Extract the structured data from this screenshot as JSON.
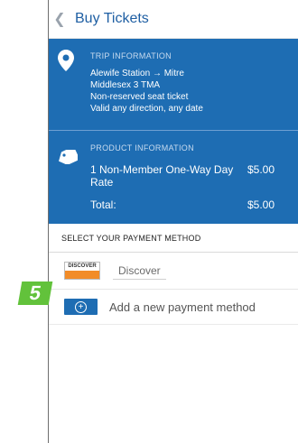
{
  "header": {
    "back_icon": "chevron-left-icon",
    "title": "Buy Tickets"
  },
  "trip": {
    "icon": "map-pin-icon",
    "label": "TRIP INFORMATION",
    "from": "Alewife Station",
    "arrow": "→",
    "to": "Mitre",
    "line2": "Middlesex 3 TMA",
    "line3": "Non-reserved seat ticket",
    "line4": "Valid any direction, any date"
  },
  "product": {
    "icon": "tag-icon",
    "label": "PRODUCT INFORMATION",
    "item": "1 Non-Member One-Way Day Rate",
    "price": "$5.00",
    "total_label": "Total:",
    "total_value": "$5.00"
  },
  "payment": {
    "section_label": "SELECT YOUR PAYMENT METHOD",
    "methods": [
      {
        "card_brand": "DISCOVER",
        "name": "Discover"
      }
    ],
    "add_label": "Add a new payment method"
  },
  "step_badge": "5",
  "colors": {
    "blue": "#1e6db3",
    "title": "#1f5fa3",
    "badge": "#62c23b",
    "card_stripe": "#f28c28"
  }
}
